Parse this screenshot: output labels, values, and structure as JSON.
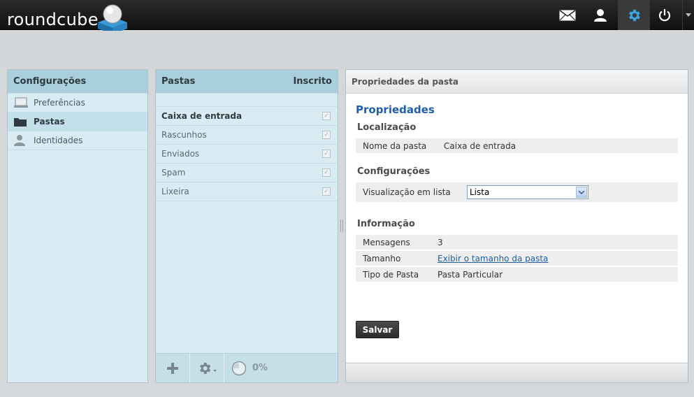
{
  "app": {
    "logo_text": "roundcube"
  },
  "topnav": {
    "items": [
      {
        "name": "mail-icon"
      },
      {
        "name": "contacts-icon"
      },
      {
        "name": "settings-icon",
        "active": true
      },
      {
        "name": "logout-icon"
      }
    ]
  },
  "settings": {
    "title": "Configurações",
    "items": [
      {
        "label": "Preferências",
        "icon": "computer-icon"
      },
      {
        "label": "Pastas",
        "icon": "folder-icon",
        "selected": true
      },
      {
        "label": "Identidades",
        "icon": "person-icon"
      }
    ]
  },
  "folders": {
    "title": "Pastas",
    "subscribed_label": "Inscrito",
    "items": [
      {
        "label": "Caixa de entrada",
        "subscribed": true
      },
      {
        "label": "Rascunhos",
        "subscribed": true
      },
      {
        "label": "Enviados",
        "subscribed": true
      },
      {
        "label": "Spam",
        "subscribed": true
      },
      {
        "label": "Lixeira",
        "subscribed": true
      }
    ],
    "quota": "0%"
  },
  "props": {
    "header": "Propriedades da pasta",
    "title": "Propriedades",
    "location": {
      "title": "Localização",
      "folder_name_label": "Nome da pasta",
      "folder_name_value": "Caixa de entrada"
    },
    "config": {
      "title": "Configurações",
      "list_view_label": "Visualização em lista",
      "list_view_value": "Lista"
    },
    "info": {
      "title": "Informação",
      "messages_label": "Mensagens",
      "messages_value": "3",
      "size_label": "Tamanho",
      "size_link": "Exibir o tamanho da pasta",
      "type_label": "Tipo de Pasta",
      "type_value": "Pasta Particular"
    },
    "save_label": "Salvar"
  },
  "colors": {
    "accent": "#1f5fa8",
    "settings_active": "#3aa6e0"
  }
}
